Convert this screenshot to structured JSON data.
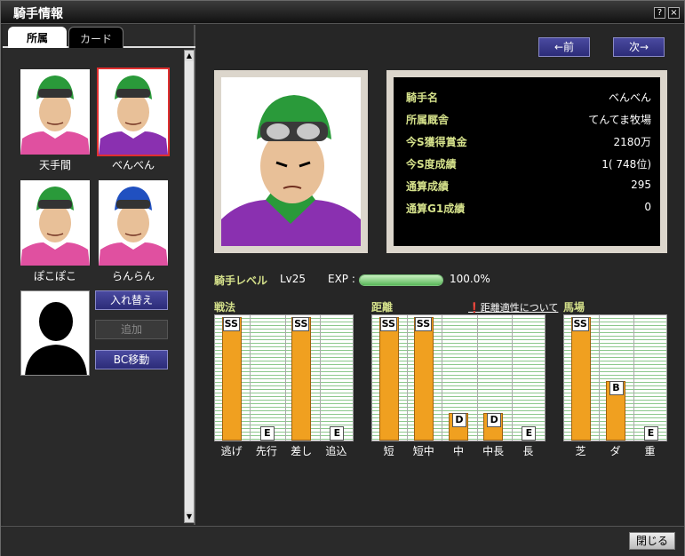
{
  "window": {
    "title": "騎手情報",
    "help": "?",
    "close": "×"
  },
  "tabs": [
    "所属",
    "カード"
  ],
  "jockeys": [
    {
      "name": "天手間",
      "helmet": "#2a9a3a",
      "shirt": "#e050a0"
    },
    {
      "name": "べんべん",
      "helmet": "#2a9a3a",
      "shirt": "#8a30b0"
    },
    {
      "name": "ぽこぽこ",
      "helmet": "#2a9a3a",
      "shirt": "#e050a0"
    },
    {
      "name": "らんらん",
      "helmet": "#2050c0",
      "shirt": "#e050a0"
    }
  ],
  "left_buttons": {
    "swap": "入れ替え",
    "add": "追加",
    "bc_move": "BC移動"
  },
  "nav": {
    "prev": "←前",
    "next": "次→"
  },
  "info": [
    {
      "key": "騎手名",
      "value": "べんべん"
    },
    {
      "key": "所属厩舎",
      "value": "てんてま牧場"
    },
    {
      "key": "今S獲得賞金",
      "value": "2180万"
    },
    {
      "key": "今S度成績",
      "value": "1( 748位)"
    },
    {
      "key": "通算成績",
      "value": "295"
    },
    {
      "key": "通算G1成績",
      "value": "0"
    }
  ],
  "level": {
    "label": "騎手レベル",
    "lv": "Lv25",
    "exp_label": "EXP :",
    "exp_value": "100.0%",
    "exp_fraction": 1.0
  },
  "sections": {
    "tactics": "戦法",
    "distance": "距離",
    "track": "馬場",
    "distance_link": "距離適性について"
  },
  "tactics": [
    {
      "label": "逃げ",
      "grade": "SS"
    },
    {
      "label": "先行",
      "grade": "E"
    },
    {
      "label": "差し",
      "grade": "SS"
    },
    {
      "label": "追込",
      "grade": "E"
    }
  ],
  "distance": [
    {
      "label": "短",
      "grade": "SS"
    },
    {
      "label": "短中",
      "grade": "SS"
    },
    {
      "label": "中",
      "grade": "D"
    },
    {
      "label": "中長",
      "grade": "D"
    },
    {
      "label": "長",
      "grade": "E"
    }
  ],
  "track": [
    {
      "label": "芝",
      "grade": "SS"
    },
    {
      "label": "ダ",
      "grade": "B"
    },
    {
      "label": "重",
      "grade": "E"
    }
  ],
  "close_button": "閉じる"
}
